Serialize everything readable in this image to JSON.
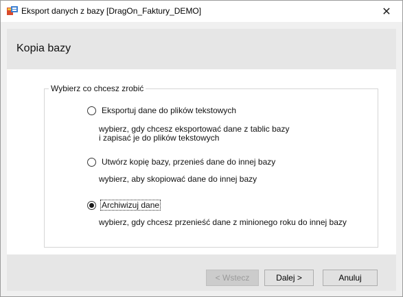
{
  "window": {
    "title": "Eksport danych z bazy [DragOn_Faktury_DEMO]",
    "close_glyph": "✕",
    "icon": "app-icon"
  },
  "header": {
    "title": "Kopia bazy"
  },
  "group": {
    "legend": "Wybierz co chcesz zrobić",
    "options": [
      {
        "label": "Eksportuj dane do plików tekstowych",
        "selected": false,
        "description_lines": [
          "wybierz, gdy chcesz eksportować dane z tablic bazy",
          "i zapisać je do plików tekstowych"
        ]
      },
      {
        "label": "Utwórz kopię bazy, przenieś dane do innej bazy",
        "selected": false,
        "description_lines": [
          "wybierz, aby skopiować dane do innej bazy"
        ]
      },
      {
        "label": "Archiwizuj dane",
        "selected": true,
        "description_lines": [
          "wybierz, gdy chcesz przenieść dane z minionego roku do innej bazy"
        ]
      }
    ]
  },
  "footer": {
    "back_label": "< Wstecz",
    "back_enabled": false,
    "next_label": "Dalej >",
    "cancel_label": "Anuluj"
  }
}
